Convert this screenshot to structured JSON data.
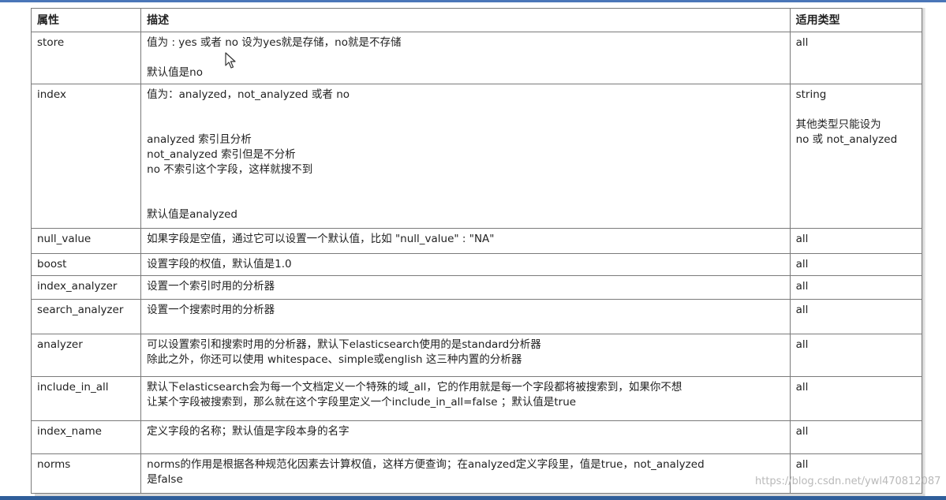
{
  "table": {
    "headers": {
      "attr": "属性",
      "desc": "描述",
      "type": "适用类型"
    },
    "rows": [
      {
        "attr": "store",
        "desc": [
          "值为 : yes 或者 no  设为yes就是存储，no就是不存储",
          "",
          "默认值是no"
        ],
        "type": [
          "all"
        ]
      },
      {
        "attr": "index",
        "desc": [
          "值为：analyzed，not_analyzed 或者 no",
          "",
          "",
          "analyzed 索引且分析",
          "not_analyzed 索引但是不分析",
          "no 不索引这个字段，这样就搜不到",
          "",
          "",
          "默认值是analyzed"
        ],
        "type": [
          "string",
          "",
          "其他类型只能设为",
          "no 或 not_analyzed"
        ]
      },
      {
        "attr": "null_value",
        "desc": [
          "如果字段是空值，通过它可以设置一个默认值，比如 \"null_value\" : \"NA\""
        ],
        "type": [
          "all"
        ]
      },
      {
        "attr": "boost",
        "desc": [
          "设置字段的权值，默认值是1.0"
        ],
        "type": [
          "all"
        ]
      },
      {
        "attr": "index_analyzer",
        "desc": [
          "设置一个索引时用的分析器"
        ],
        "type": [
          "all"
        ]
      },
      {
        "attr": "search_analyzer",
        "desc": [
          "设置一个搜索时用的分析器"
        ],
        "type": [
          "all"
        ]
      },
      {
        "attr": "analyzer",
        "desc": [
          "可以设置索引和搜索时用的分析器，默认下elasticsearch使用的是standard分析器",
          "除此之外，你还可以使用 whitespace、simple或english 这三种内置的分析器"
        ],
        "type": [
          "all"
        ]
      },
      {
        "attr": "include_in_all",
        "desc": [
          "默认下elasticsearch会为每一个文档定义一个特殊的域_all，它的作用就是每一个字段都将被搜索到，如果你不想",
          "让某个字段被搜索到，那么就在这个字段里定义一个include_in_all=false ；默认值是true"
        ],
        "type": [
          "all"
        ]
      },
      {
        "attr": "index_name",
        "desc": [
          "定义字段的名称；默认值是字段本身的名字"
        ],
        "type": [
          "all"
        ]
      },
      {
        "attr": "norms",
        "desc": [
          "norms的作用是根据各种规范化因素去计算权值，这样方便查询；在analyzed定义字段里，值是true，not_analyzed",
          "是false"
        ],
        "type": [
          "all"
        ]
      }
    ]
  },
  "watermark": "https://blog.csdn.net/ywl470812087"
}
